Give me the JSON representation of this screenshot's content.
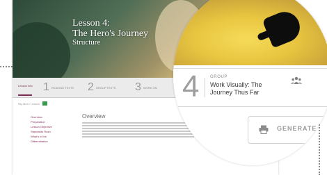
{
  "course_page": {
    "hero_title_line1": "Lesson 4:",
    "hero_title_line2": "The Hero's Journey",
    "hero_title_line3": "Structure",
    "steps": [
      {
        "num": "1",
        "label": "READING TEXTS"
      },
      {
        "num": "2",
        "label": "GROUP TEXTS"
      },
      {
        "num": "3",
        "label": "WORK ON"
      }
    ],
    "active_tab": "Lesson Info",
    "breadcrumb": "Big Idea / Lesson",
    "side_nav": [
      "Overview",
      "Preparation",
      "Lesson Objective",
      "Standards Rush",
      "What's in the",
      "Differentiation"
    ],
    "overview_title": "Overview",
    "footer_label": "Reset"
  },
  "lens": {
    "card": {
      "number": "4",
      "kicker": "GROUP",
      "title": "Work Visually: The Journey Thus Far",
      "icon": "group-icon"
    },
    "generate_button": {
      "label": "GENERATE",
      "icon": "print-icon"
    }
  },
  "colors": {
    "accent": "#7a2b52",
    "badge": "#3a9a4f",
    "lens_highlight": "#f0d458"
  }
}
